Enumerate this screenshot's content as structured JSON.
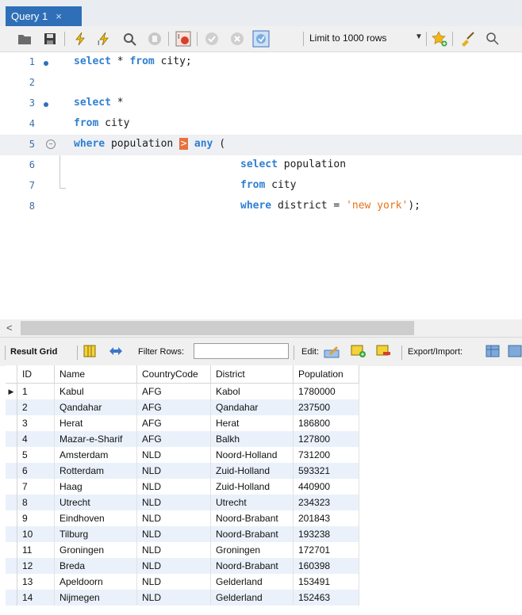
{
  "tab": {
    "title": "Query 1",
    "close": "×"
  },
  "toolbar": {
    "limit_label": "Limit to 1000 rows",
    "colors": {
      "accent": "#2f6fb7",
      "keyword": "#2f7fd3",
      "string": "#e8721c"
    }
  },
  "editor": {
    "lines": [
      {
        "num": "1"
      },
      {
        "num": "2"
      },
      {
        "num": "3"
      },
      {
        "num": "4"
      },
      {
        "num": "5"
      },
      {
        "num": "6"
      },
      {
        "num": "7"
      },
      {
        "num": "8"
      }
    ],
    "tokens": {
      "l1_kw": "select",
      "l1_plain": " * ",
      "l1_kw2": "from",
      "l1_plain2": " city;",
      "l3_kw": "select",
      "l3_plain": " *",
      "l4_kw": "from",
      "l4_plain": " city",
      "l5_kw": "where",
      "l5_plain": " population ",
      "l5_err": ">",
      "l5_kw2": " any",
      "l5_plain2": " (",
      "l6_kw": "select",
      "l6_plain": " population",
      "l7_kw": "from",
      "l7_plain": " city",
      "l8_kw": "where",
      "l8_plain": " district = ",
      "l8_str": "'new york'",
      "l8_plain2": ");"
    }
  },
  "result_toolbar": {
    "result_grid": "Result Grid",
    "filter_rows": "Filter Rows:",
    "filter_value": "",
    "edit": "Edit:",
    "export_import": "Export/Import:"
  },
  "grid": {
    "columns": [
      "ID",
      "Name",
      "CountryCode",
      "District",
      "Population"
    ],
    "rows": [
      [
        "1",
        "Kabul",
        "AFG",
        "Kabol",
        "1780000"
      ],
      [
        "2",
        "Qandahar",
        "AFG",
        "Qandahar",
        "237500"
      ],
      [
        "3",
        "Herat",
        "AFG",
        "Herat",
        "186800"
      ],
      [
        "4",
        "Mazar-e-Sharif",
        "AFG",
        "Balkh",
        "127800"
      ],
      [
        "5",
        "Amsterdam",
        "NLD",
        "Noord-Holland",
        "731200"
      ],
      [
        "6",
        "Rotterdam",
        "NLD",
        "Zuid-Holland",
        "593321"
      ],
      [
        "7",
        "Haag",
        "NLD",
        "Zuid-Holland",
        "440900"
      ],
      [
        "8",
        "Utrecht",
        "NLD",
        "Utrecht",
        "234323"
      ],
      [
        "9",
        "Eindhoven",
        "NLD",
        "Noord-Brabant",
        "201843"
      ],
      [
        "10",
        "Tilburg",
        "NLD",
        "Noord-Brabant",
        "193238"
      ],
      [
        "11",
        "Groningen",
        "NLD",
        "Groningen",
        "172701"
      ],
      [
        "12",
        "Breda",
        "NLD",
        "Noord-Brabant",
        "160398"
      ],
      [
        "13",
        "Apeldoorn",
        "NLD",
        "Gelderland",
        "153491"
      ],
      [
        "14",
        "Nijmegen",
        "NLD",
        "Gelderland",
        "152463"
      ]
    ]
  }
}
